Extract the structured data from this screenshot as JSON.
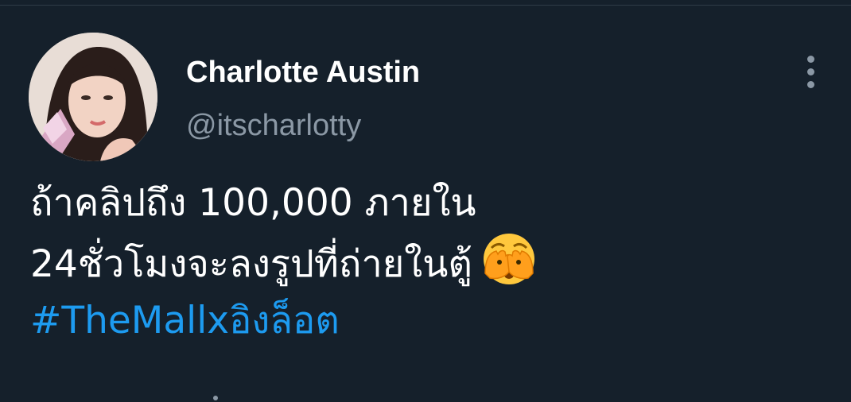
{
  "tweet": {
    "author": {
      "display_name": "Charlotte Austin",
      "handle": "@itscharlotty",
      "avatar_icon": "profile-photo"
    },
    "menu_icon": "more-vertical-icon",
    "text_lines": [
      "ถ้าคลิปถึง 100,000 ภายใน",
      "24ชั่วโมงจะลงรูปที่ถ่ายในตู้"
    ],
    "emoji_icon": "face-with-hand-over-eyes-emoji",
    "hashtag": "#TheMallxอิงล็อต"
  },
  "colors": {
    "background": "#15202b",
    "name": "#ffffff",
    "handle": "#8b98a5",
    "link": "#1d9bf0"
  }
}
